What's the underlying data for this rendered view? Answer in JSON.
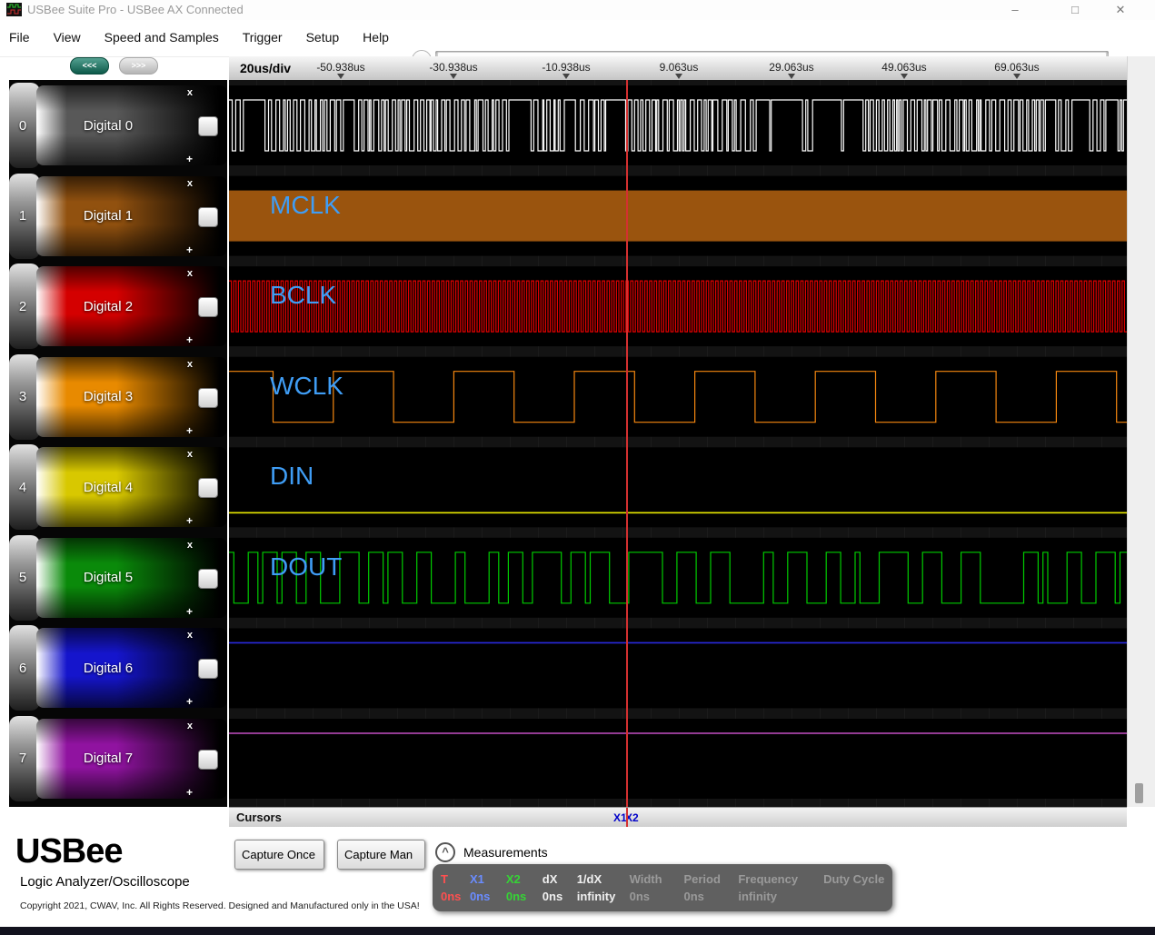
{
  "window": {
    "title": "USBee Suite Pro - USBee AX Connected",
    "controls": {
      "minimize": "–",
      "maximize": "□",
      "close": "✕"
    }
  },
  "menu": {
    "items": [
      "File",
      "View",
      "Speed and Samples",
      "Trigger",
      "Setup",
      "Help"
    ]
  },
  "nav": {
    "back_label": "<<<",
    "forward_label": ">>>",
    "scroll_left_icon": "‹"
  },
  "timeline": {
    "scale": "20us/div",
    "ticks": [
      "-50.938us",
      "-30.938us",
      "-10.938us",
      "9.063us",
      "29.063us",
      "49.063us",
      "69.063us"
    ]
  },
  "marks": {
    "close": "x",
    "add": "+"
  },
  "channels": [
    {
      "number": "0",
      "label": "Digital 0",
      "color": "#585858",
      "signal": {
        "type": "random",
        "color": "#ffffff",
        "seed": 11
      }
    },
    {
      "number": "1",
      "label": "Digital 1",
      "color": "#91510f",
      "annotation": "MCLK",
      "signal": {
        "type": "solid",
        "color": "#9a540e"
      }
    },
    {
      "number": "2",
      "label": "Digital 2",
      "color": "#d40000",
      "annotation": "BCLK",
      "signal": {
        "type": "clock",
        "color": "#e00000",
        "half": 2.6,
        "phase": 2.6
      }
    },
    {
      "number": "3",
      "label": "Digital 3",
      "color": "#e88a00",
      "annotation": "WCLK",
      "signal": {
        "type": "clock",
        "color": "#f5870f",
        "half": 66.3,
        "phase": 48.5
      }
    },
    {
      "number": "4",
      "label": "Digital 4",
      "color": "#d8c800",
      "annotation": "DIN",
      "signal": {
        "type": "flat",
        "color": "#e9e900",
        "level": "low"
      }
    },
    {
      "number": "5",
      "label": "Digital 5",
      "color": "#0a8a0a",
      "annotation": "DOUT",
      "signal": {
        "type": "bits",
        "color": "#00cc00",
        "seed": 7
      }
    },
    {
      "number": "6",
      "label": "Digital 6",
      "color": "#1515cc",
      "signal": {
        "type": "flat",
        "color": "#2a2ae0",
        "level": "high"
      }
    },
    {
      "number": "7",
      "label": "Digital 7",
      "color": "#9013a0",
      "signal": {
        "type": "flat",
        "color": "#c44fc4",
        "level": "high"
      }
    }
  ],
  "cursors": {
    "label": "Cursors",
    "x1": "X1",
    "x2": "X2"
  },
  "branding": {
    "logo": "USBee",
    "subtitle": "Logic Analyzer/Oscilloscope",
    "copyright": "Copyright 2021, CWAV, Inc. All Rights Reserved. Designed and Manufactured only in the USA!"
  },
  "controls": {
    "capture_once": "Capture Once",
    "capture_manual": "Capture Man",
    "measurements_label": "Measurements",
    "measurements_toggle_icon": "^"
  },
  "measurements": [
    {
      "name": "T",
      "value": "0ns",
      "color": "#ff5050"
    },
    {
      "name": "X1",
      "value": "0ns",
      "color": "#6a8cff"
    },
    {
      "name": "X2",
      "value": "0ns",
      "color": "#35d435"
    },
    {
      "name": "dX",
      "value": "0ns",
      "color": "#f0f0f0"
    },
    {
      "name": "1/dX",
      "value": "infinity",
      "color": "#f0f0f0"
    },
    {
      "name": "Width",
      "value": "0ns",
      "color": "#9a9a9a"
    },
    {
      "name": "Period",
      "value": "0ns",
      "color": "#9a9a9a"
    },
    {
      "name": "Frequency",
      "value": "infinity",
      "color": "#9a9a9a"
    },
    {
      "name": "Duty Cycle",
      "value": "",
      "color": "#9a9a9a"
    }
  ]
}
